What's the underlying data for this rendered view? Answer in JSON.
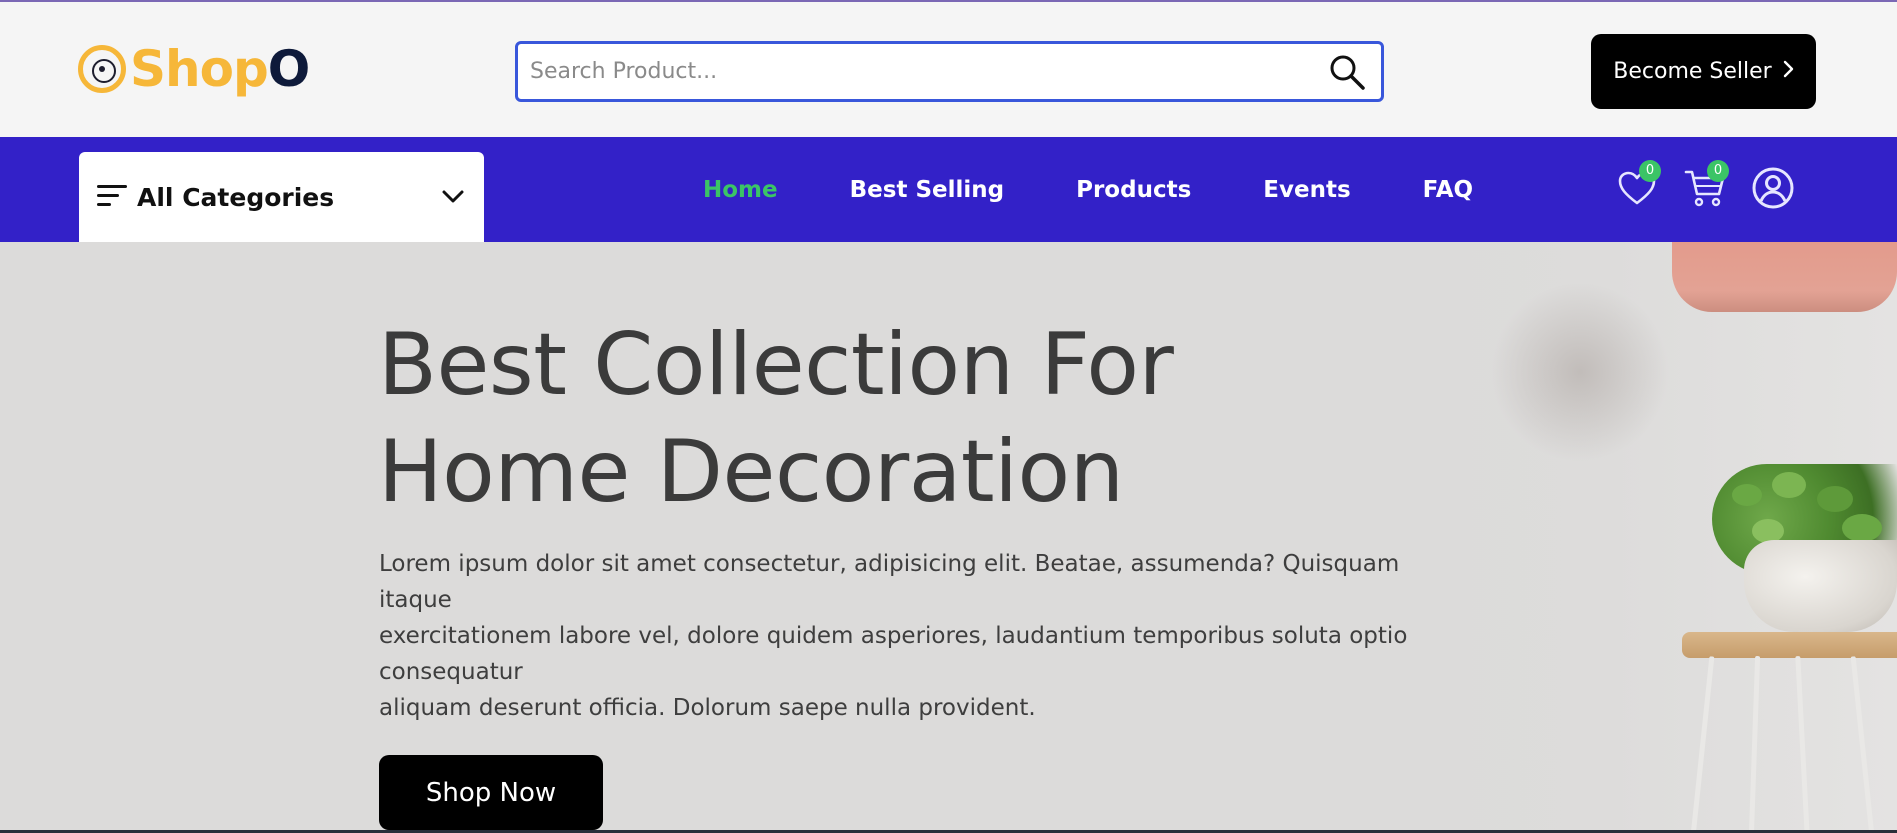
{
  "header": {
    "logo": {
      "part1": "Shop",
      "part2": "O"
    },
    "search": {
      "placeholder": "Search Product...",
      "value": ""
    },
    "become_seller": "Become Seller"
  },
  "navbar": {
    "categories_label": "All Categories",
    "links": [
      {
        "label": "Home",
        "active": true
      },
      {
        "label": "Best Selling",
        "active": false
      },
      {
        "label": "Products",
        "active": false
      },
      {
        "label": "Events",
        "active": false
      },
      {
        "label": "FAQ",
        "active": false
      }
    ],
    "wishlist_count": "0",
    "cart_count": "0"
  },
  "hero": {
    "title_line1": "Best Collection For",
    "title_line2": "Home Decoration",
    "desc_line1": "Lorem ipsum dolor sit amet consectetur, adipisicing elit. Beatae, assumenda? Quisquam",
    "desc_line2": "itaque",
    "desc_line3": "exercitationem labore vel, dolore quidem asperiores, laudantium temporibus soluta optio",
    "desc_line4": "consequatur",
    "desc_line5": "aliquam deserunt officia. Dolorum saepe nulla provident.",
    "cta": "Shop Now"
  },
  "colors": {
    "nav_bg": "#3321c8",
    "active_link": "#3bc466",
    "logo_yellow": "#f6b739",
    "search_border": "#3957db",
    "hero_bg": "#dcdbda"
  },
  "icons": [
    "logo-icon",
    "search-icon",
    "chevron-right-icon",
    "menu-lines-icon",
    "chevron-down-icon",
    "heart-icon",
    "cart-icon",
    "user-icon"
  ]
}
